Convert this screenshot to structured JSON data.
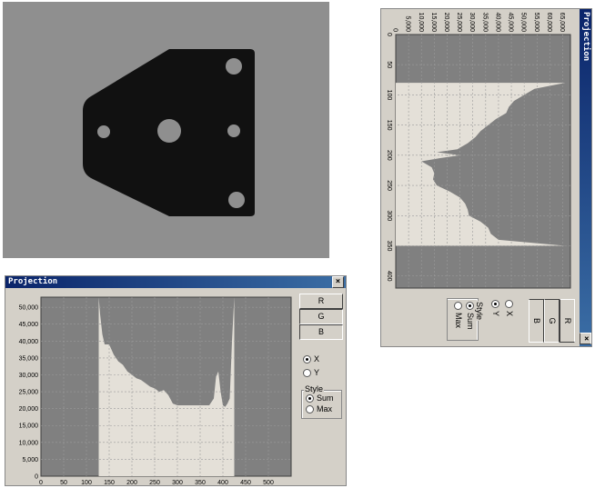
{
  "bottom_dialog": {
    "title": "Projection",
    "close": "×",
    "buttons": [
      "R",
      "G",
      "B"
    ],
    "axis_options": [
      "X",
      "Y"
    ],
    "selected_axis": "X",
    "style_group": "Style",
    "style_options": [
      "Sum",
      "Max"
    ],
    "selected_style": "Sum"
  },
  "right_dialog": {
    "title": "Projection",
    "close": "×",
    "buttons": [
      "R",
      "G",
      "B"
    ],
    "axis_options": [
      "X",
      "Y"
    ],
    "selected_axis": "X",
    "style_group": "Style",
    "style_options": [
      "Sum",
      "Max"
    ],
    "selected_style": "Sum"
  },
  "colors": {
    "plot_background": "#808080",
    "fill": "#e4e0d8",
    "photo_background": "#8f8f8f",
    "part": "#111111"
  },
  "chart_data": [
    {
      "type": "area",
      "x_ticks": [
        "0",
        "50",
        "100",
        "150",
        "200",
        "250",
        "300",
        "350",
        "400",
        "450",
        "500"
      ],
      "y_ticks": [
        "0",
        "5,000",
        "10,000",
        "15,000",
        "20,000",
        "25,000",
        "30,000",
        "35,000",
        "40,000",
        "45,000",
        "50,000"
      ],
      "xlim": [
        0,
        550
      ],
      "ylim": [
        0,
        53000
      ],
      "grid": true,
      "x": [
        127,
        130,
        135,
        140,
        150,
        160,
        170,
        180,
        190,
        200,
        210,
        220,
        230,
        240,
        250,
        260,
        270,
        280,
        290,
        300,
        310,
        320,
        330,
        340,
        350,
        360,
        370,
        380,
        385,
        390,
        395,
        400,
        405,
        410,
        415,
        420,
        425
      ],
      "y": [
        53000,
        48000,
        42000,
        39000,
        39000,
        36000,
        34000,
        33000,
        31000,
        30000,
        29000,
        28500,
        27500,
        26500,
        26000,
        25000,
        25500,
        24000,
        21500,
        21000,
        21000,
        21000,
        21000,
        21000,
        21000,
        21000,
        21000,
        23000,
        29500,
        31000,
        25000,
        21000,
        20500,
        21500,
        23000,
        40000,
        53000
      ]
    },
    {
      "type": "area",
      "x_ticks": [
        "0",
        "5,000",
        "10,000",
        "15,000",
        "20,000",
        "25,000",
        "30,000",
        "35,000",
        "40,000",
        "45,000",
        "50,000",
        "55,000",
        "60,000",
        "65,000"
      ],
      "y_ticks": [
        "0",
        "50",
        "100",
        "150",
        "200",
        "250",
        "300",
        "350",
        "400"
      ],
      "xlim": [
        0,
        68000
      ],
      "ylim": [
        0,
        420
      ],
      "grid": true,
      "y": [
        80,
        90,
        100,
        110,
        120,
        130,
        140,
        150,
        160,
        170,
        180,
        190,
        195,
        200,
        205,
        210,
        220,
        230,
        240,
        250,
        260,
        270,
        280,
        290,
        300,
        310,
        320,
        330,
        340,
        350
      ],
      "x": [
        66000,
        54000,
        50000,
        46000,
        44000,
        43000,
        39000,
        36000,
        33000,
        31000,
        28000,
        24000,
        16000,
        25000,
        17000,
        10000,
        14000,
        15000,
        14500,
        16000,
        21000,
        25000,
        27000,
        28000,
        28500,
        33000,
        36000,
        37000,
        40000,
        66000
      ]
    }
  ]
}
